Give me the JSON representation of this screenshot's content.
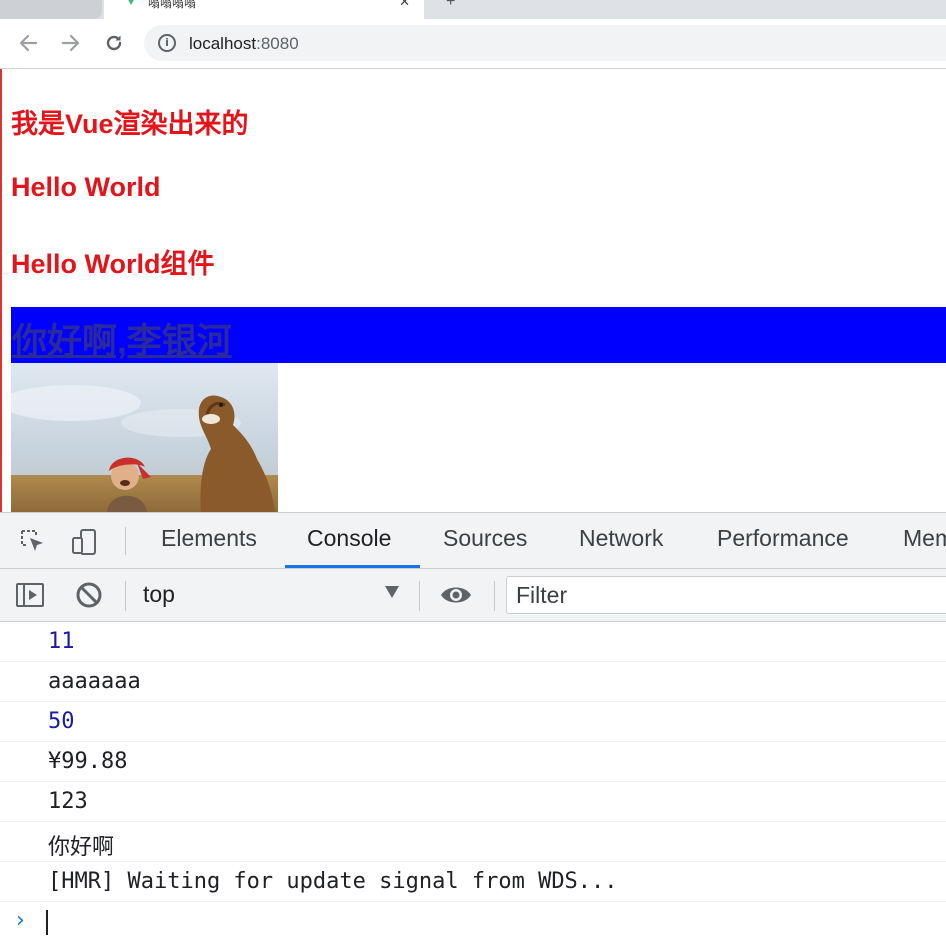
{
  "browser": {
    "tab_title": "嗡嗡嗡嗡",
    "tab_close": "✕",
    "new_tab": "+",
    "url_host": "localhost",
    "url_port": ":8080"
  },
  "page": {
    "heading1": "我是Vue渲染出来的",
    "heading2": "Hello World",
    "heading3": "Hello World组件",
    "banner_link": "你好啊,李银河",
    "colors": {
      "heading": "#e4141b",
      "banner": "#0000ff"
    }
  },
  "devtools": {
    "tabs": [
      "Elements",
      "Console",
      "Sources",
      "Network",
      "Performance",
      "Mem"
    ],
    "active_tab": "Console",
    "context": "top",
    "filter_placeholder": "Filter",
    "console_lines": [
      {
        "text": "11",
        "kind": "number"
      },
      {
        "text": "aaaaaaa",
        "kind": "string"
      },
      {
        "text": "50",
        "kind": "number"
      },
      {
        "text": "¥99.88",
        "kind": "string"
      },
      {
        "text": "123",
        "kind": "string"
      },
      {
        "text": "你好啊",
        "kind": "string"
      },
      {
        "text": "[HMR] Waiting for update signal from WDS...",
        "kind": "string"
      }
    ],
    "colors": {
      "accent": "#1a73e8",
      "number": "#1a1aa6"
    }
  }
}
